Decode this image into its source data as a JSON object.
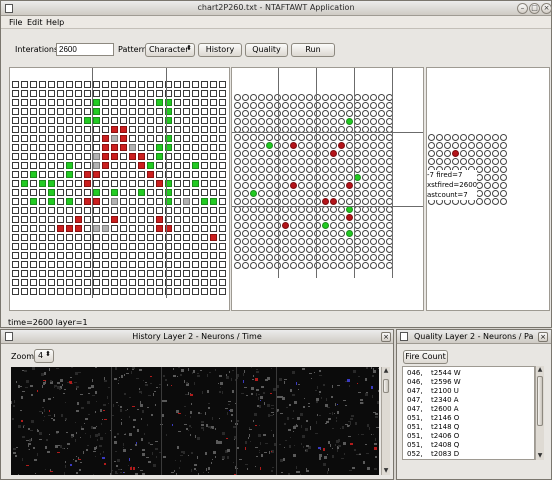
{
  "window": {
    "title": "chart2P260.txt - NTAFTAWT Application"
  },
  "menu": [
    {
      "label": "File"
    },
    {
      "label": "Edit"
    },
    {
      "label": "Help"
    }
  ],
  "toolbar": {
    "iterations_label": "Interations",
    "iterations_value": "2600",
    "pattern_label": "Pattern",
    "pattern_value": "Character",
    "history_button": "History",
    "quality_button": "Quality",
    "run_button": "Run"
  },
  "grid_layer1": {
    "rows": [
      "........................",
      "........................",
      ".........g......gg......",
      ".........g.......g......",
      "........gg.......g......",
      "...........rr...........",
      "..........rsr....g......",
      "..........rrrs..gg......",
      ".........srr.rr.g.......",
      "......g..sr...rg....g...",
      "..g...g.rr.....r........",
      ".g.gg...r.......rg..g...",
      "....g....g.g..g..g......",
      "..g.g.g.rr.s.....g.s.gg.",
      "........................",
      ".......r...r....r.......",
      ".....rrr.ss.....rr......",
      "......................r.",
      "........................",
      "........................",
      "........................",
      "........................",
      "........................",
      "........................"
    ]
  },
  "grid_layer2": {
    "rows": [
      "....................",
      "....................",
      "....................",
      "..............g.....",
      "....................",
      "....................",
      "....g..r.....r......",
      "............r.......",
      "....................",
      "....................",
      "...............g....",
      ".......r......r.....",
      "..g.................",
      "...........rr.......",
      "..............g.....",
      "..............r.....",
      "......r....g........",
      "..............g.....",
      "....................",
      "....................",
      "....................",
      "...................."
    ]
  },
  "grid_layer3": {
    "rows": [
      "..........",
      "..........",
      "...r......",
      "..........",
      "..........",
      "..........",
      "..........",
      "..........",
      ".........."
    ],
    "info_lines": [
      "-7 fired=7",
      "xstfired=2600",
      "astcount=7"
    ]
  },
  "status": "time=2600 layer=1",
  "history_window": {
    "title": "History Layer 2 - Neurons / Time",
    "zoom_label": "Zoom",
    "zoom_value": "4"
  },
  "quality_window": {
    "title": "Quality Layer 2 - Neurons / Pa",
    "fire_count_button": "Fire Count",
    "rows": [
      {
        "id": "046,",
        "value": "t2544 W"
      },
      {
        "id": "046,",
        "value": "t2596 W"
      },
      {
        "id": "047,",
        "value": "t2100 U"
      },
      {
        "id": "047,",
        "value": "t2340 A"
      },
      {
        "id": "047,",
        "value": "t2600 A"
      },
      {
        "id": "051,",
        "value": "t2146 O"
      },
      {
        "id": "051,",
        "value": "t2148 Q"
      },
      {
        "id": "051,",
        "value": "t2406 O"
      },
      {
        "id": "051,",
        "value": "t2408 Q"
      },
      {
        "id": "052,",
        "value": "t2083 D"
      }
    ]
  },
  "colors": {
    "fired_green": "#22cc22",
    "active_red": "#cc1f1f",
    "inhibit_grey": "#b3b3b3"
  }
}
